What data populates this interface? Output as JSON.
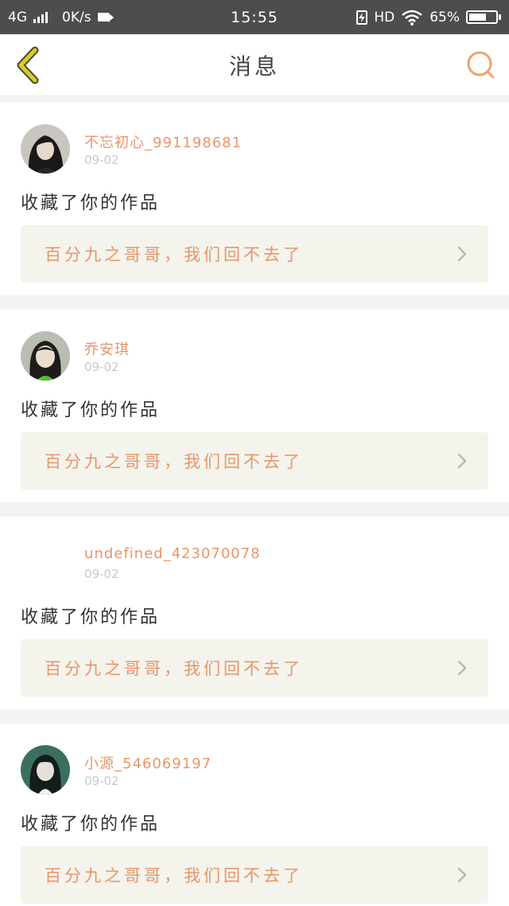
{
  "status_bar": {
    "network": "4G",
    "speed": "0K/s",
    "time": "15:55",
    "hd": "HD",
    "battery": "65%"
  },
  "header": {
    "title": "消息",
    "back_icon": "chevron-left-icon",
    "search_icon": "search-icon"
  },
  "messages": [
    {
      "username": "不忘初心_991198681",
      "date": "09-02",
      "action": "收藏了你的作品",
      "work_title": "百分九之哥哥，我们回不去了"
    },
    {
      "username": "乔安琪",
      "date": "09-02",
      "action": "收藏了你的作品",
      "work_title": "百分九之哥哥，我们回不去了"
    },
    {
      "username": "undefined_423070078",
      "date": "09-02",
      "action": "收藏了你的作品",
      "work_title": "百分九之哥哥，我们回不去了"
    },
    {
      "username": "小源_546069197",
      "date": "09-02",
      "action": "收藏了你的作品",
      "work_title": "百分九之哥哥，我们回不去了"
    }
  ],
  "colors": {
    "accent": "#e8956a",
    "header_icon": "#c9bf24",
    "link_bg": "#f4f4ec"
  }
}
